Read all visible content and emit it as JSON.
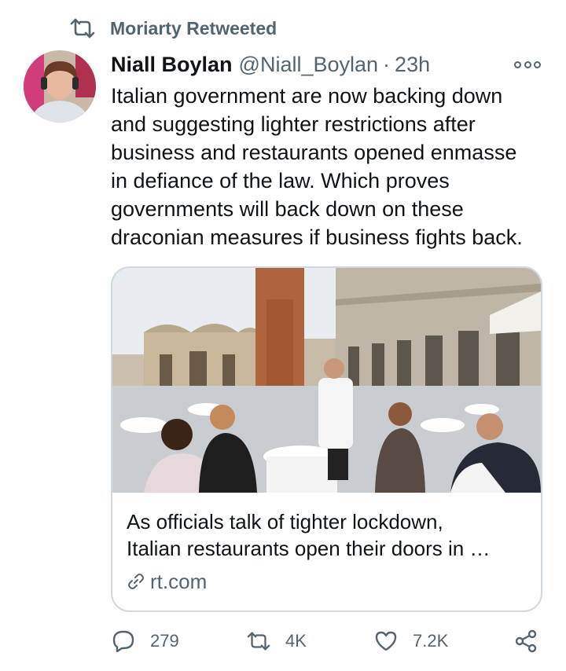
{
  "retweet_banner": {
    "label": "Moriarty Retweeted",
    "icon": "retweet-icon"
  },
  "tweet": {
    "author_name": "Niall Boylan",
    "author_handle": "@Niall_Boylan",
    "separator": "·",
    "time": "23h",
    "text_lines": [
      "Italian government are now backing down",
      "and suggesting lighter restrictions after",
      "business and restaurants opened enmasse",
      "in defiance of the law. Which proves",
      "governments will back down on these",
      "draconian measures if business fights back."
    ]
  },
  "card": {
    "title_lines": [
      "As officials talk of tighter lockdown,",
      "Italian restaurants open their doors in …"
    ],
    "domain": "rt.com",
    "link_icon": "link-icon"
  },
  "actions": {
    "reply_count": "279",
    "retweet_count": "4K",
    "like_count": "7.2K"
  },
  "colors": {
    "text": "#0f1419",
    "secondary": "#536471",
    "border": "#cfd9de"
  }
}
